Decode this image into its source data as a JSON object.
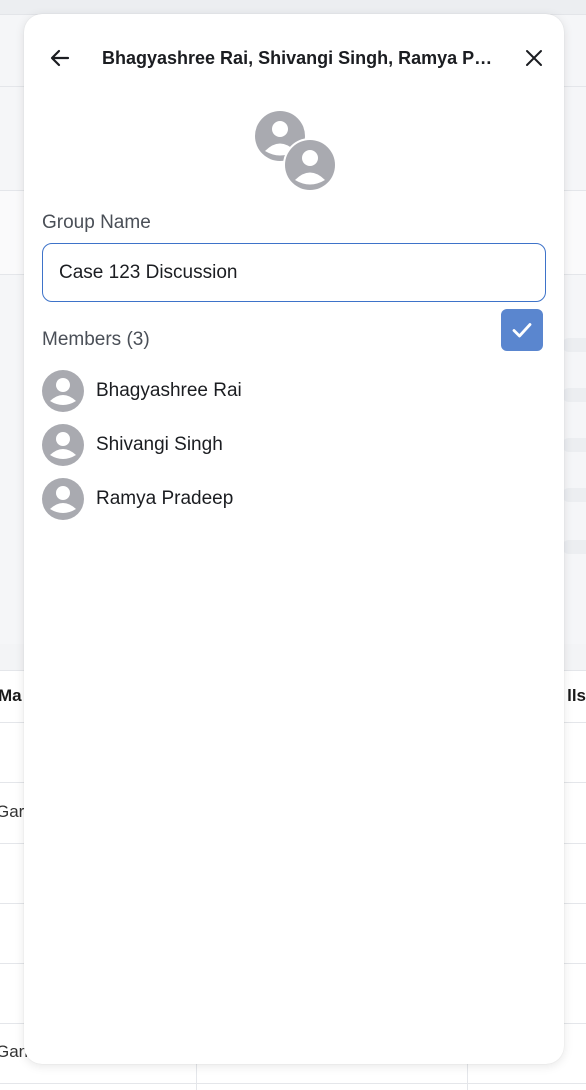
{
  "background": {
    "header_fragment": "Ma",
    "header_fragment_right": "lls",
    "row_fragments": [
      "Gar",
      "Gan"
    ]
  },
  "modal": {
    "title": "Bhagyashree Rai, Shivangi Singh, Ramya Pradeep",
    "back_icon": "arrow-left-icon",
    "close_icon": "close-icon",
    "group_avatar_icon": "group-users-icon",
    "group_name_label": "Group Name",
    "group_name_value": "Case 123 Discussion",
    "confirm_icon": "check-icon",
    "members_label": "Members (3)",
    "members": [
      {
        "name": "Bhagyashree Rai",
        "avatar_icon": "user-avatar-icon"
      },
      {
        "name": "Shivangi Singh",
        "avatar_icon": "user-avatar-icon"
      },
      {
        "name": "Ramya Pradeep",
        "avatar_icon": "user-avatar-icon"
      }
    ]
  },
  "colors": {
    "accent": "#5a86cf",
    "input_border": "#3e73c9",
    "avatar_gray": "#a9aab0"
  }
}
